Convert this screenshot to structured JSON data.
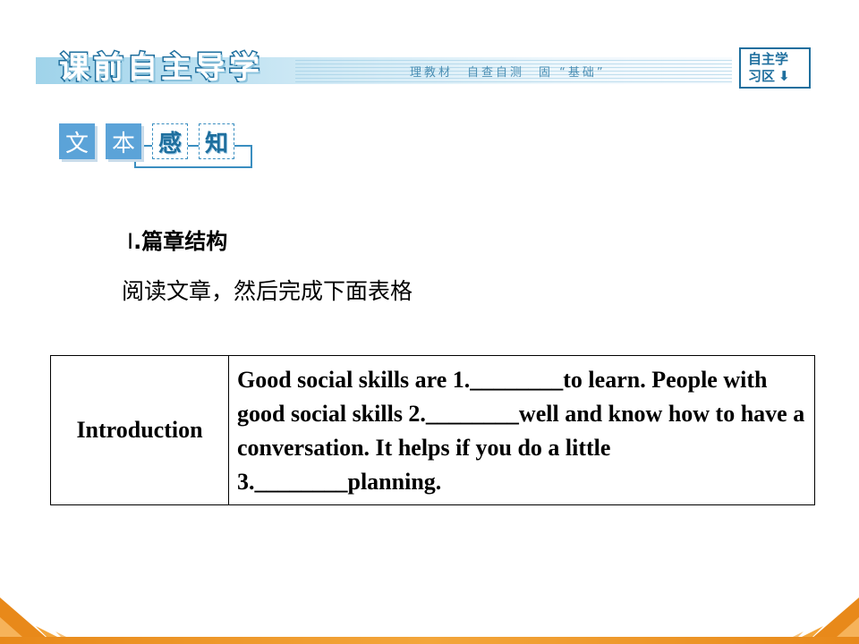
{
  "header": {
    "title": "课前自主导学",
    "subtitle": "理教材　自查自测　固 “基础”",
    "zone_line1": "自主学",
    "zone_line2": "习区"
  },
  "badge": {
    "chars": [
      "文",
      "本",
      "感",
      "知"
    ]
  },
  "section": {
    "roman": "Ⅰ",
    "title": ".篇章结构",
    "instruction": "阅读文章，然后完成下面表格"
  },
  "table": {
    "rows": [
      {
        "label": "Introduction",
        "content": "Good social skills are 1.________to learn. People with good social skills 2.________well and know how to have a conversation. It helps if you do a little 3.________planning."
      }
    ]
  },
  "colors": {
    "accent_blue": "#1f6f9e",
    "chip_blue": "#5ba3d8",
    "footer_orange": "#e8891a"
  }
}
